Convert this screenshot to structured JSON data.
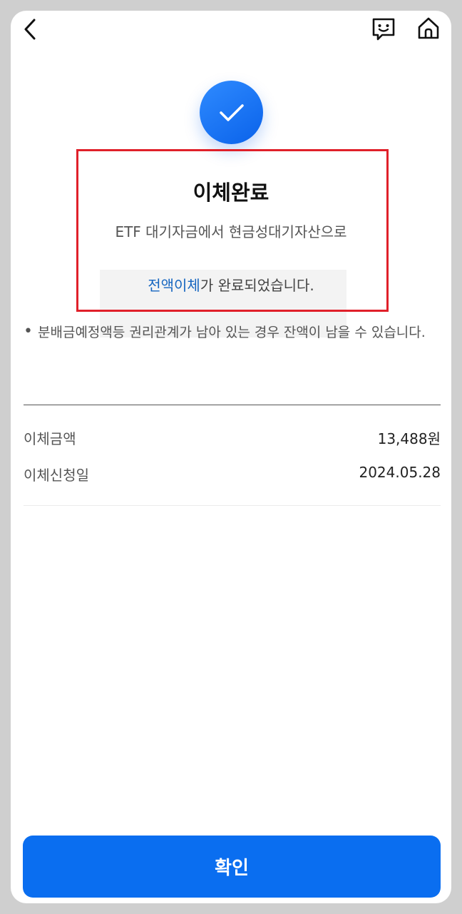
{
  "result": {
    "title": "이체완료",
    "subtitle": "ETF 대기자금에서 현금성대기자산으로",
    "complete_accent": "전액이체",
    "complete_rest": "가 완료되었습니다."
  },
  "notice": {
    "bullet": "•",
    "text": "분배금예정액등 권리관계가 남아 있는 경우 잔액이 남을 수 있습니다."
  },
  "details": [
    {
      "label": "이체금액",
      "value": "13,488원"
    },
    {
      "label": "이체신청일",
      "value": "2024.05.28"
    }
  ],
  "buttons": {
    "confirm": "확인"
  },
  "colors": {
    "primary": "#0a6ef0",
    "accent_text": "#1565c0",
    "highlight_border": "#e0202a"
  }
}
